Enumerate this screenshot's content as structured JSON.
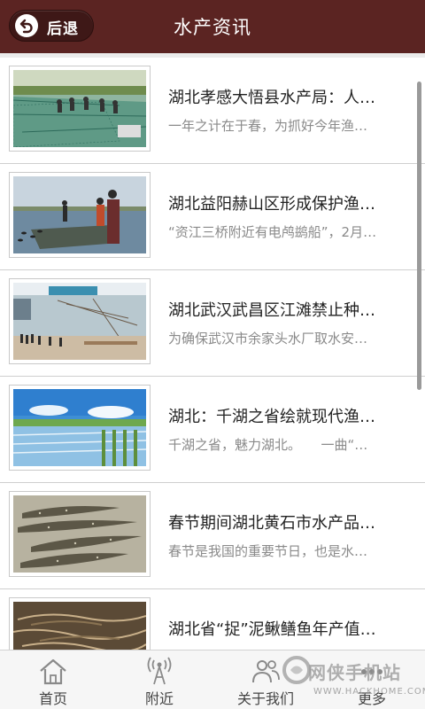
{
  "header": {
    "back_label": "后退",
    "title": "水产资讯"
  },
  "articles": [
    {
      "title": "湖北孝感大悟县水产局：人…",
      "summary": "一年之计在于春，为抓好今年渔…"
    },
    {
      "title": "湖北益阳赫山区形成保护渔…",
      "summary": "“资江三桥附近有电鸬鹚船”，2月…"
    },
    {
      "title": "湖北武汉武昌区江滩禁止种…",
      "summary": "为确保武汉市余家头水厂取水安…"
    },
    {
      "title": "湖北：千湖之省绘就现代渔…",
      "summary": "千湖之省，魅力湖北。　　一曲“…"
    },
    {
      "title": "春节期间湖北黄石市水产品…",
      "summary": "春节是我国的重要节日，也是水…"
    },
    {
      "title": "湖北省“捉”泥鳅鳝鱼年产值…",
      "summary": ""
    }
  ],
  "tabs": [
    {
      "label": "首页"
    },
    {
      "label": "附近"
    },
    {
      "label": "关于我们"
    },
    {
      "label": "更多"
    }
  ],
  "watermark": {
    "text": "网侠手机站",
    "url": "WWW.HACKHOME.COM"
  },
  "colors": {
    "header_bg": "#5b2422",
    "back_button_bg": "#3e1817"
  }
}
